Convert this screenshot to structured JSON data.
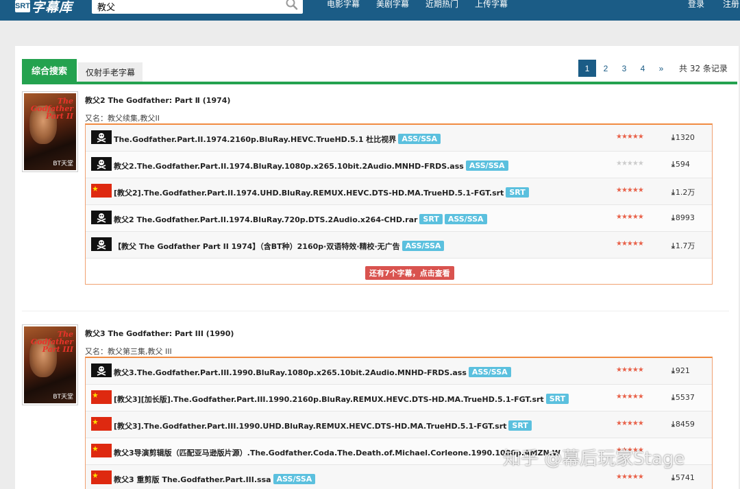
{
  "header": {
    "logo_text": "字幕库",
    "search_value": "教父",
    "nav": [
      "电影字幕",
      "美剧字幕",
      "近期热门",
      "上传字幕"
    ],
    "login": "登录",
    "register": "注册"
  },
  "tabs": {
    "active": "综合搜索",
    "inactive": "仅射手老字幕"
  },
  "pager": {
    "pages": [
      "1",
      "2",
      "3",
      "4",
      "»"
    ],
    "total": "共 32 条记录"
  },
  "movies": [
    {
      "title": "教父2 The Godfather: Part Ⅱ (1974)",
      "aka": "又名：教父续集,教父II",
      "poster_title": "The Godfather Part II",
      "poster_badge": "BT天堂",
      "subs": [
        {
          "flag": "pirate",
          "name": "The.Godfather.Part.II.1974.2160p.BluRay.HEVC.TrueHD.5.1 杜比视界",
          "tags": [
            "ASS/SSA"
          ],
          "rating": 5,
          "downloads": "1320"
        },
        {
          "flag": "pirate",
          "name": "教父2.The.Godfather.Part.II.1974.BluRay.1080p.x265.10bit.2Audio.MNHD-FRDS.ass",
          "tags": [
            "ASS/SSA"
          ],
          "rating": 0,
          "downloads": "594"
        },
        {
          "flag": "cn",
          "name": "[教父2].The.Godfather.Part.II.1974.UHD.BluRay.REMUX.HEVC.DTS-HD.MA.TrueHD.5.1-FGT.srt",
          "tags": [
            "SRT"
          ],
          "rating": 5,
          "downloads": "1.2万"
        },
        {
          "flag": "pirate",
          "name": "教父2 The.Godfather.Part.II.1974.BluRay.720p.DTS.2Audio.x264-CHD.rar",
          "tags": [
            "SRT",
            "ASS/SSA"
          ],
          "rating": 5,
          "downloads": "8993"
        },
        {
          "flag": "pirate",
          "name": "【教父 The Godfather Part II 1974】（含BT种）2160p·双语特效·精校·无广告",
          "tags": [
            "ASS/SSA"
          ],
          "rating": 5,
          "downloads": "1.7万"
        }
      ],
      "more": "还有7个字幕，点击查看"
    },
    {
      "title": "教父3 The Godfather: Part III (1990)",
      "aka": "又名：教父第三集,教父 III",
      "poster_title": "The Godfather Part III",
      "poster_badge": "BT天堂",
      "subs": [
        {
          "flag": "pirate",
          "name": "教父3.The.Godfather.Part.III.1990.BluRay.1080p.x265.10bit.2Audio.MNHD-FRDS.ass",
          "tags": [
            "ASS/SSA"
          ],
          "rating": 5,
          "downloads": "921"
        },
        {
          "flag": "cn",
          "name": "[教父3][加长版].The.Godfather.Part.III.1990.2160p.BluRay.REMUX.HEVC.DTS-HD.MA.TrueHD.5.1-FGT.srt",
          "tags": [
            "SRT"
          ],
          "rating": 5,
          "downloads": "5537"
        },
        {
          "flag": "cn",
          "name": "[教父3].The.Godfather.Part.III.1990.UHD.BluRay.REMUX.HEVC.DTS-HD.MA.TrueHD.5.1-FGT.srt",
          "tags": [
            "SRT"
          ],
          "rating": 5,
          "downloads": "8459"
        },
        {
          "flag": "cn",
          "name": "教父3导演剪辑版（匹配亚马逊版片源）.The.Godfather.Coda.The.Death.of.Michael.Corleone.1990.1080p.AMZN.W",
          "tags": [],
          "rating": 5,
          "downloads": ""
        },
        {
          "flag": "cn",
          "name": "教父3 重剪版 The.Godfather.Part.III.ssa",
          "tags": [
            "ASS/SSA"
          ],
          "rating": 5,
          "downloads": "5741"
        }
      ]
    }
  ],
  "watermark": "知乎 @幕后玩家Stage",
  "colors": {
    "header": "#1b5c86",
    "green": "#24a24f",
    "tag": "#5bc0de",
    "star": "#e8624a",
    "more": "#d9534f"
  }
}
